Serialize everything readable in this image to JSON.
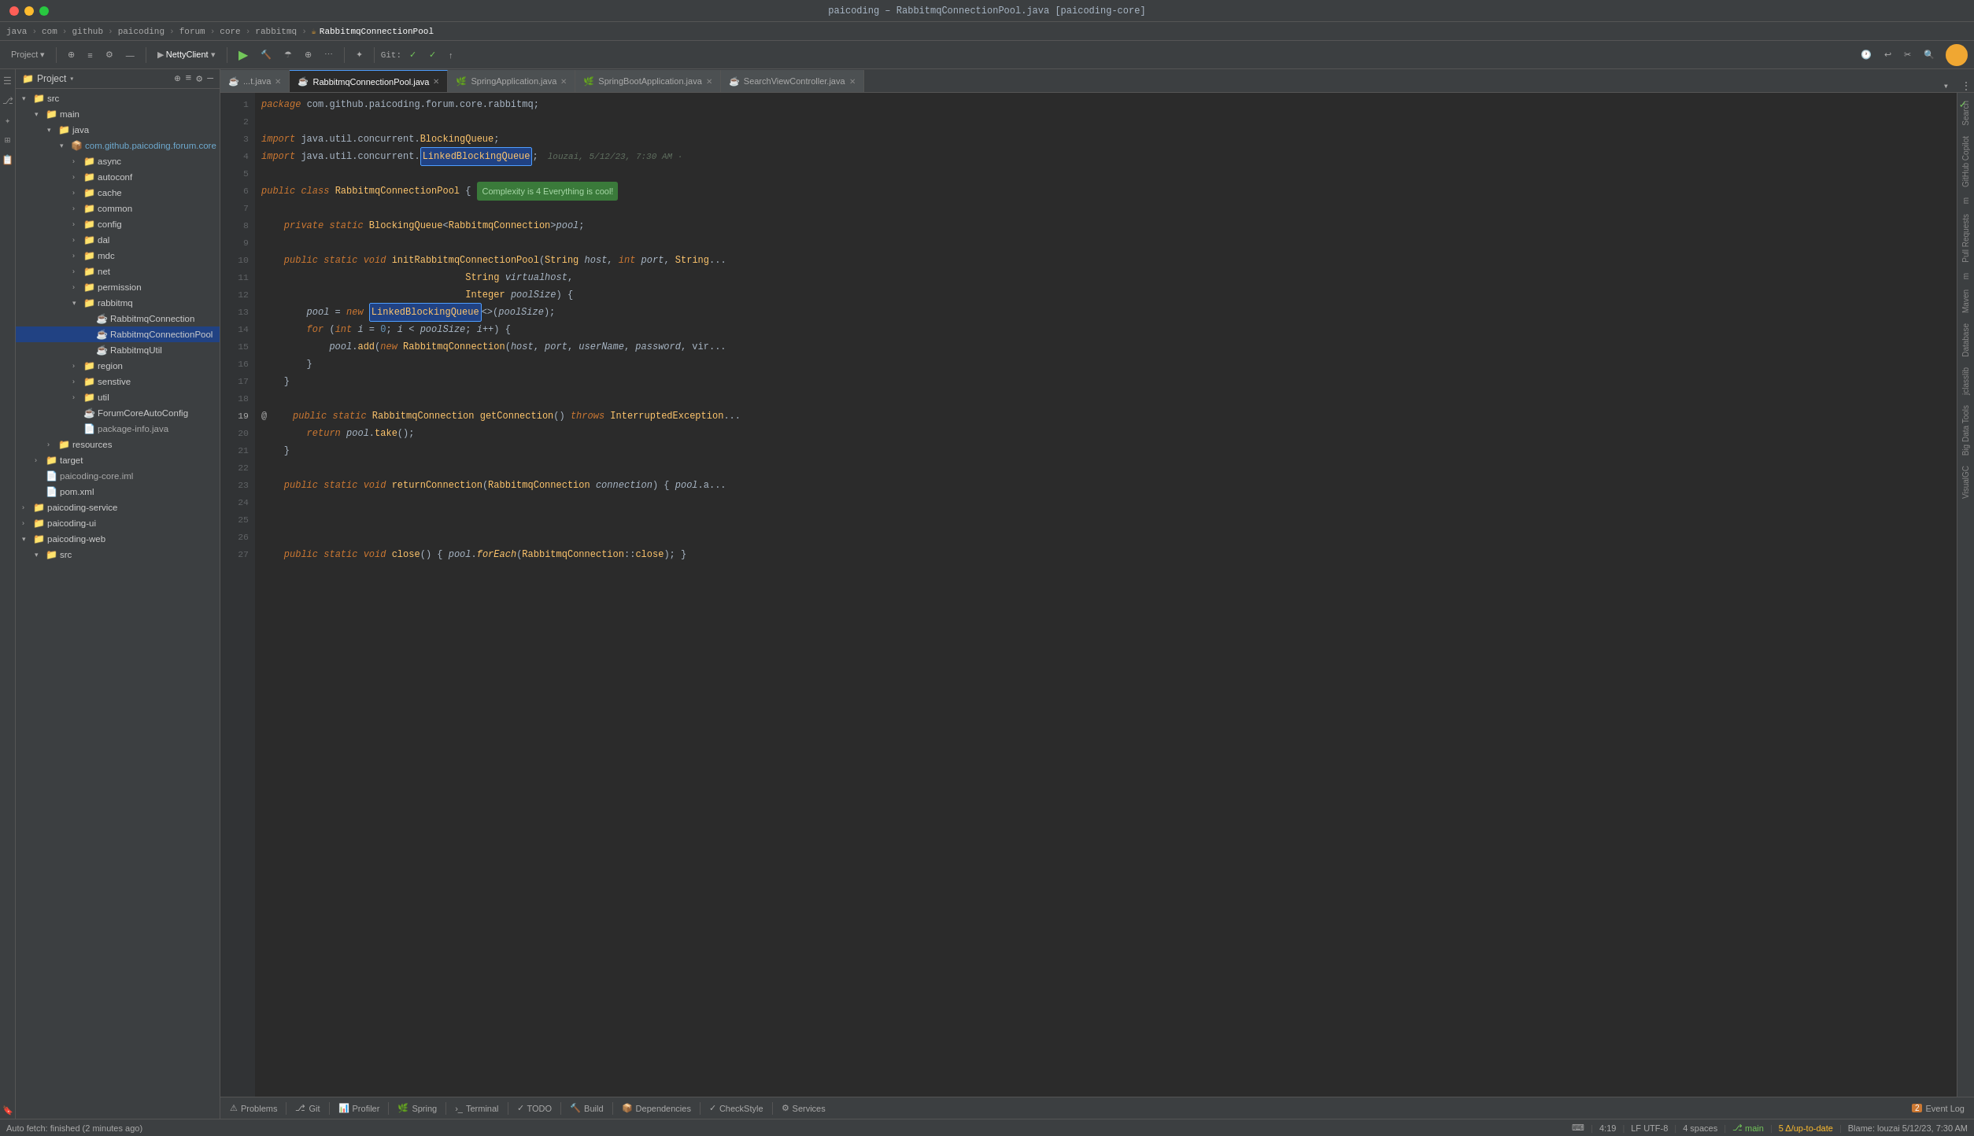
{
  "titleBar": {
    "text": "paicoding – RabbitmqConnectionPool.java [paicoding-core]"
  },
  "breadcrumb": {
    "items": [
      "java",
      "com",
      "github",
      "paicoding",
      "forum",
      "core",
      "rabbitmq",
      "RabbitmqConnectionPool"
    ]
  },
  "toolbar": {
    "nettyClient": "NettyClient",
    "gitLabel": "Git:",
    "runIcon": "▶",
    "buildIcon": "🔨"
  },
  "projectPanel": {
    "title": "Project",
    "items": [
      {
        "label": "src",
        "indent": 0,
        "type": "folder",
        "expanded": true
      },
      {
        "label": "main",
        "indent": 1,
        "type": "folder",
        "expanded": true
      },
      {
        "label": "java",
        "indent": 2,
        "type": "folder",
        "expanded": true
      },
      {
        "label": "com.github.paicoding.forum.core",
        "indent": 3,
        "type": "package",
        "expanded": true
      },
      {
        "label": "async",
        "indent": 4,
        "type": "folder"
      },
      {
        "label": "autoconf",
        "indent": 4,
        "type": "folder"
      },
      {
        "label": "cache",
        "indent": 4,
        "type": "folder"
      },
      {
        "label": "common",
        "indent": 4,
        "type": "folder"
      },
      {
        "label": "config",
        "indent": 4,
        "type": "folder"
      },
      {
        "label": "dal",
        "indent": 4,
        "type": "folder"
      },
      {
        "label": "mdc",
        "indent": 4,
        "type": "folder"
      },
      {
        "label": "net",
        "indent": 4,
        "type": "folder"
      },
      {
        "label": "permission",
        "indent": 4,
        "type": "folder"
      },
      {
        "label": "rabbitmq",
        "indent": 4,
        "type": "folder",
        "expanded": true
      },
      {
        "label": "RabbitmqConnection",
        "indent": 5,
        "type": "java"
      },
      {
        "label": "RabbitmqConnectionPool",
        "indent": 5,
        "type": "java",
        "selected": true
      },
      {
        "label": "RabbitmqUtil",
        "indent": 5,
        "type": "java"
      },
      {
        "label": "region",
        "indent": 4,
        "type": "folder"
      },
      {
        "label": "senstive",
        "indent": 4,
        "type": "folder"
      },
      {
        "label": "util",
        "indent": 4,
        "type": "folder"
      },
      {
        "label": "ForumCoreAutoConfig",
        "indent": 4,
        "type": "java"
      },
      {
        "label": "package-info.java",
        "indent": 4,
        "type": "java-plain"
      },
      {
        "label": "resources",
        "indent": 3,
        "type": "folder"
      },
      {
        "label": "target",
        "indent": 2,
        "type": "folder-target"
      },
      {
        "label": "paicoding-core.iml",
        "indent": 2,
        "type": "iml"
      },
      {
        "label": "pom.xml",
        "indent": 2,
        "type": "xml"
      },
      {
        "label": "paicoding-service",
        "indent": 1,
        "type": "module"
      },
      {
        "label": "paicoding-ui",
        "indent": 1,
        "type": "module"
      },
      {
        "label": "paicoding-web",
        "indent": 1,
        "type": "module",
        "expanded": true
      },
      {
        "label": "src",
        "indent": 2,
        "type": "folder"
      }
    ]
  },
  "tabs": [
    {
      "label": "...t.java",
      "type": "java",
      "active": false,
      "closable": true
    },
    {
      "label": "RabbitmqConnectionPool.java",
      "type": "java",
      "active": true,
      "closable": true
    },
    {
      "label": "SpringApplication.java",
      "type": "spring",
      "active": false,
      "closable": true
    },
    {
      "label": "SpringBootApplication.java",
      "type": "spring",
      "active": false,
      "closable": true
    },
    {
      "label": "SearchViewController.java",
      "type": "java",
      "active": false,
      "closable": true
    }
  ],
  "codeLines": [
    {
      "num": 1,
      "content": "package com.github.paicoding.forum.core.rabbitmq;"
    },
    {
      "num": 2,
      "content": ""
    },
    {
      "num": 3,
      "content": "import java.util.concurrent.BlockingQueue;"
    },
    {
      "num": 4,
      "content": "import java.util.concurrent.LinkedBlockingQueue;",
      "blame": "louzai, 5/12/23, 7:30 AM"
    },
    {
      "num": 5,
      "content": ""
    },
    {
      "num": 6,
      "content": "public class RabbitmqConnectionPool {",
      "complexity": "Complexity is 4 Everything is cool!"
    },
    {
      "num": 7,
      "content": ""
    },
    {
      "num": 8,
      "content": "    private static BlockingQueue<RabbitmqConnection> pool;"
    },
    {
      "num": 9,
      "content": ""
    },
    {
      "num": 10,
      "content": "    public static void initRabbitmqConnectionPool(String host, int port, String..."
    },
    {
      "num": 11,
      "content": "                                    String virtualhost,"
    },
    {
      "num": 12,
      "content": "                                    Integer poolSize) {"
    },
    {
      "num": 13,
      "content": "        pool = new LinkedBlockingQueue<>(poolSize);"
    },
    {
      "num": 14,
      "content": "        for (int i = 0; i < poolSize; i++) {"
    },
    {
      "num": 15,
      "content": "            pool.add(new RabbitmqConnection(host, port, userName, password, vir..."
    },
    {
      "num": 16,
      "content": "        }"
    },
    {
      "num": 17,
      "content": "    }"
    },
    {
      "num": 18,
      "content": ""
    },
    {
      "num": 19,
      "content": "    public static RabbitmqConnection getConnection() throws InterruptedException...",
      "atSymbol": true
    },
    {
      "num": 20,
      "content": "        return pool.take();"
    },
    {
      "num": 21,
      "content": "    }"
    },
    {
      "num": 22,
      "content": ""
    },
    {
      "num": 23,
      "content": "    public static void returnConnection(RabbitmqConnection connection) { pool.a..."
    },
    {
      "num": 24,
      "content": ""
    },
    {
      "num": 25,
      "content": ""
    },
    {
      "num": 26,
      "content": ""
    },
    {
      "num": 27,
      "content": "    public static void close() { pool.forEach(RabbitmqConnection::close); }"
    }
  ],
  "rightSidebar": {
    "items": [
      "Search",
      "GitHub Copilot",
      "m",
      "Pull Requests",
      "m",
      "Maven",
      "Database",
      "jclasslib",
      "Big Data Tools",
      "VisualGC"
    ]
  },
  "bottomTabs": [
    {
      "label": "Problems",
      "icon": "⚠"
    },
    {
      "label": "Git",
      "icon": "⎇"
    },
    {
      "label": "Profiler",
      "icon": "📊"
    },
    {
      "label": "Spring",
      "icon": "🌿"
    },
    {
      "label": "Terminal",
      "icon": ">_"
    },
    {
      "label": "TODO",
      "icon": "✓"
    },
    {
      "label": "Build",
      "icon": "🔨"
    },
    {
      "label": "Dependencies",
      "icon": "📦"
    },
    {
      "label": "CheckStyle",
      "icon": "✓"
    },
    {
      "label": "Services",
      "icon": "⚙"
    },
    {
      "label": "Event Log",
      "icon": "📋"
    }
  ],
  "statusBar": {
    "autoFetch": "Auto fetch: finished (2 minutes ago)",
    "position": "4:19",
    "encoding": "LF  UTF-8",
    "indent": "4 spaces",
    "branch": "main",
    "gitStatus": "5 Δ/up-to-date",
    "blame": "Blame: louzai 5/12/23, 7:30 AM"
  }
}
